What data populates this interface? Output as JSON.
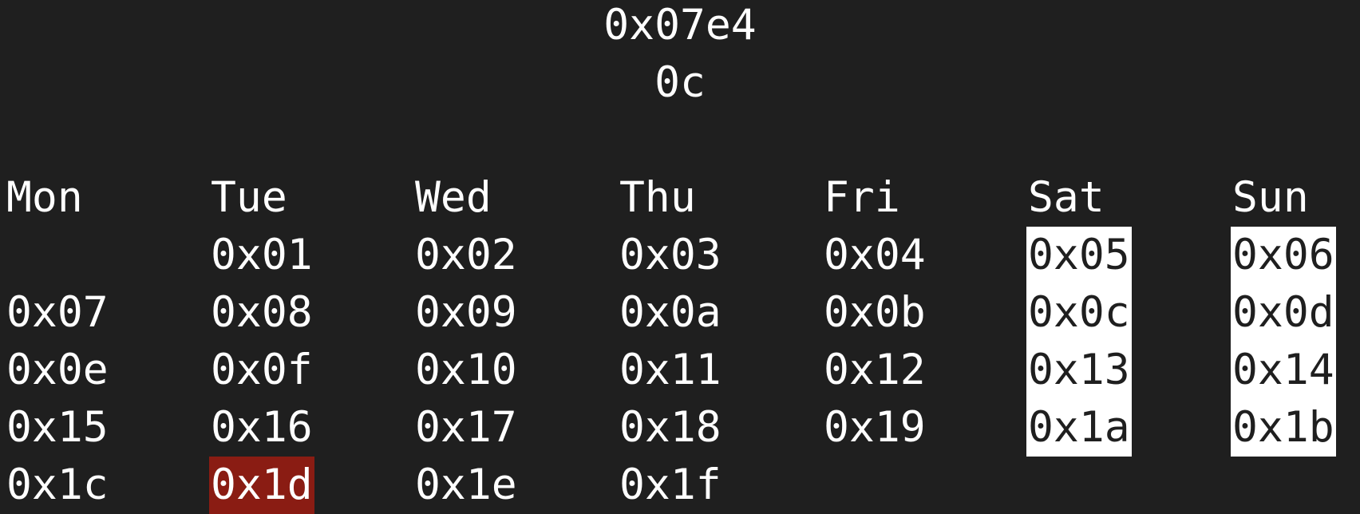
{
  "calendar": {
    "year": "0x07e4",
    "month": "0c",
    "weekdays": [
      "Mon",
      "Tue",
      "Wed",
      "Thu",
      "Fri",
      "Sat",
      "Sun"
    ],
    "weeks": [
      [
        "",
        "0x01",
        "0x02",
        "0x03",
        "0x04",
        "0x05",
        "0x06"
      ],
      [
        "0x07",
        "0x08",
        "0x09",
        "0x0a",
        "0x0b",
        "0x0c",
        "0x0d"
      ],
      [
        "0x0e",
        "0x0f",
        "0x10",
        "0x11",
        "0x12",
        "0x13",
        "0x14"
      ],
      [
        "0x15",
        "0x16",
        "0x17",
        "0x18",
        "0x19",
        "0x1a",
        "0x1b"
      ],
      [
        "0x1c",
        "0x1d",
        "0x1e",
        "0x1f",
        "",
        "",
        ""
      ]
    ],
    "today": "0x1d",
    "colors": {
      "background": "#1f1f1f",
      "text": "#ffffff",
      "weekend_highlight": "#ffffff",
      "today_highlight": "#8a1c13"
    }
  }
}
